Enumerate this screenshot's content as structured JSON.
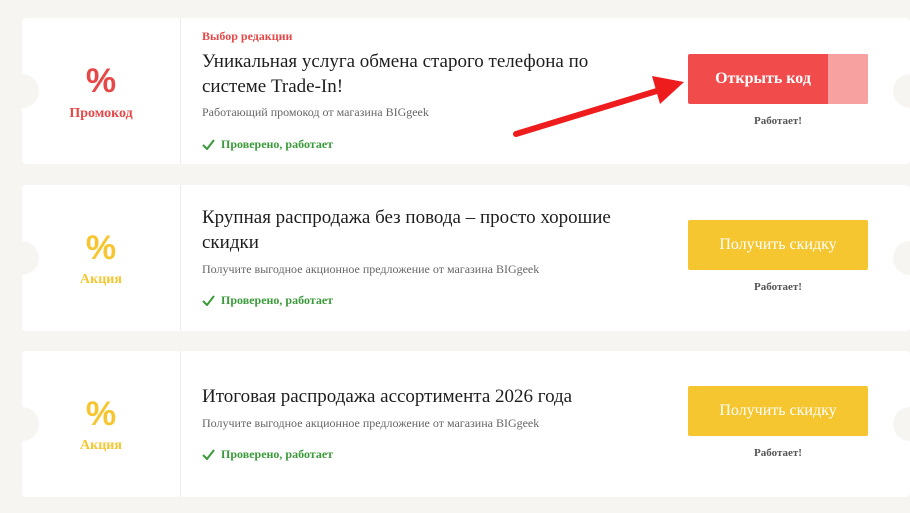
{
  "offers": [
    {
      "badge_symbol": "%",
      "kind": "Промокод",
      "editors_choice": "Выбор редакции",
      "title": "Уникальная услуга обмена старого телефона по системе Trade-In!",
      "subtitle": "Работающий промокод от магазина BIGgeek",
      "verified": "Проверено, работает",
      "button_label": "Открыть код",
      "status": "Работает!"
    },
    {
      "badge_symbol": "%",
      "kind": "Акция",
      "title": "Крупная распродажа без повода – просто хорошие скидки",
      "subtitle": "Получите выгодное акционное предложение от магазина BIGgeek",
      "verified": "Проверено, работает",
      "button_label": "Получить скидку",
      "status": "Работает!"
    },
    {
      "badge_symbol": "%",
      "kind": "Акция",
      "title": "Итоговая распродажа ассортимента 2026 года",
      "subtitle": "Получите выгодное акционное предложение от магазина BIGgeek",
      "verified": "Проверено, работает",
      "button_label": "Получить скидку",
      "status": "Работает!"
    }
  ],
  "colors": {
    "promo_red": "#e54848",
    "action_yellow": "#f5c630",
    "verified_green": "#3a9a3a"
  },
  "icons": [
    "check-icon",
    "annotation-arrow-icon"
  ]
}
